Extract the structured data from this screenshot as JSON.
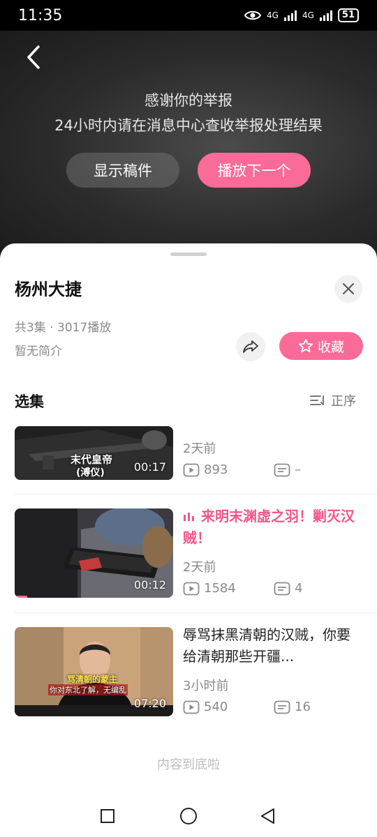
{
  "status_bar": {
    "time": "11:35",
    "net1": "4G",
    "net2": "4G",
    "battery": "51"
  },
  "video": {
    "report_line1": "感谢你的举报",
    "report_line2": "24小时内请在消息中心查收举报处理结果",
    "show_label": "显示稿件",
    "next_label": "播放下一个"
  },
  "sheet": {
    "title": "杨州大捷",
    "meta": "共3集 · 3017播放",
    "intro": "暂无简介",
    "fav_label": "收藏",
    "episodes_heading": "选集",
    "sort_label": "正序",
    "episodes": [
      {
        "title": "",
        "time": "2天前",
        "views": "893",
        "comments": "–",
        "duration": "00:17",
        "caption1": "末代皇帝",
        "caption2": "(溥仪)"
      },
      {
        "title": "来明末渊虚之羽！剿灭汉贼！",
        "time": "2天前",
        "views": "1584",
        "comments": "4",
        "duration": "00:12"
      },
      {
        "title": "辱骂抹黑清朝的汉贼，你要给清朝那些开疆...",
        "time": "3小时前",
        "views": "540",
        "comments": "16",
        "duration": "07:20",
        "caption1": "骂清朝的蒙主",
        "caption2": "你对东北了解，无编乱"
      }
    ],
    "end_text": "内容到底啦"
  },
  "colors": {
    "accent": "#fb6b98",
    "accent_text": "#f4558a"
  }
}
